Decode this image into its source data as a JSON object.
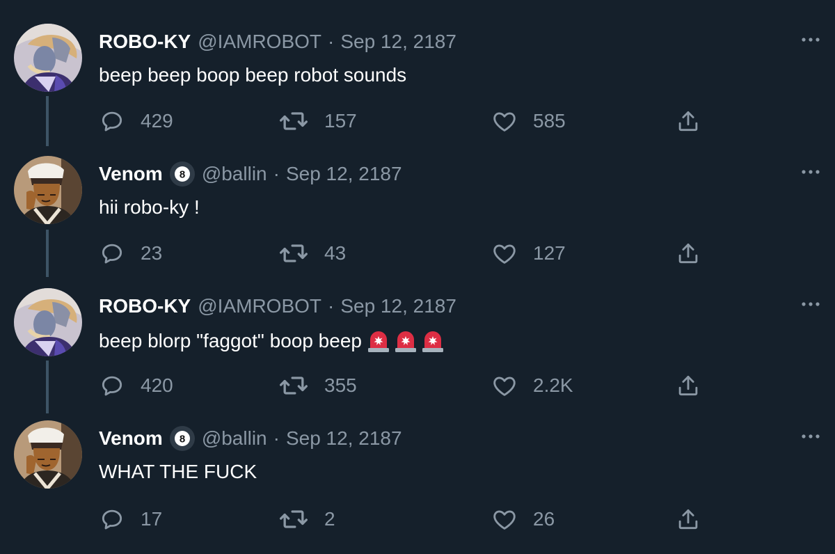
{
  "tweets": [
    {
      "name": "ROBO-KY",
      "handle": "@IAMROBOT",
      "separator": "·",
      "date": "Sep 12, 2187",
      "text": "beep beep boop beep robot sounds",
      "replies": "429",
      "retweets": "157",
      "likes": "585",
      "verified_badge": false,
      "avatar": "robo-ky-avatar"
    },
    {
      "name": "Venom",
      "handle": "@ballin",
      "separator": "·",
      "date": "Sep 12, 2187",
      "text": "hii robo-ky !",
      "replies": "23",
      "retweets": "43",
      "likes": "127",
      "badge": "8",
      "avatar": "venom-avatar"
    },
    {
      "name": "ROBO-KY",
      "handle": "@IAMROBOT",
      "separator": "·",
      "date": "Sep 12, 2187",
      "text": "beep blorp \"faggot\" boop beep",
      "emoji": [
        "siren-emoji",
        "siren-emoji",
        "siren-emoji"
      ],
      "replies": "420",
      "retweets": "355",
      "likes": "2.2K",
      "avatar": "robo-ky-avatar"
    },
    {
      "name": "Venom",
      "handle": "@ballin",
      "separator": "·",
      "date": "Sep 12, 2187",
      "text": "WHAT THE FUCK",
      "replies": "17",
      "retweets": "2",
      "likes": "26",
      "badge": "8",
      "avatar": "venom-avatar"
    }
  ],
  "colors": {
    "background": "#15202b",
    "text": "#ffffff",
    "secondary": "#8b98a5",
    "thread_line": "#3d5466"
  },
  "icons": [
    "reply-icon",
    "retweet-icon",
    "like-icon",
    "share-icon",
    "more-icon"
  ]
}
